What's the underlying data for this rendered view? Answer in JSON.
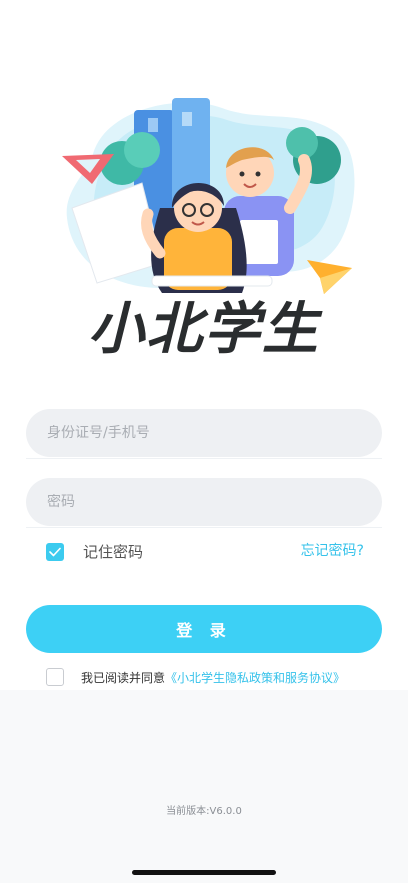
{
  "app": {
    "logo_text": "小北学生"
  },
  "login_form": {
    "account_placeholder": "身份证号/手机号",
    "password_placeholder": "密码",
    "remember_label": "记住密码",
    "remember_checked": true,
    "forgot_label": "忘记密码?",
    "login_label": "登 录"
  },
  "agreement": {
    "checked": false,
    "prefix": "我已阅读并同意",
    "link_text": "《小北学生隐私政策和服务协议》"
  },
  "footer": {
    "version_text": "当前版本:V6.0.0"
  },
  "colors": {
    "accent": "#3dd0f5",
    "link": "#35c2ea",
    "field_bg": "#eef0f3"
  }
}
